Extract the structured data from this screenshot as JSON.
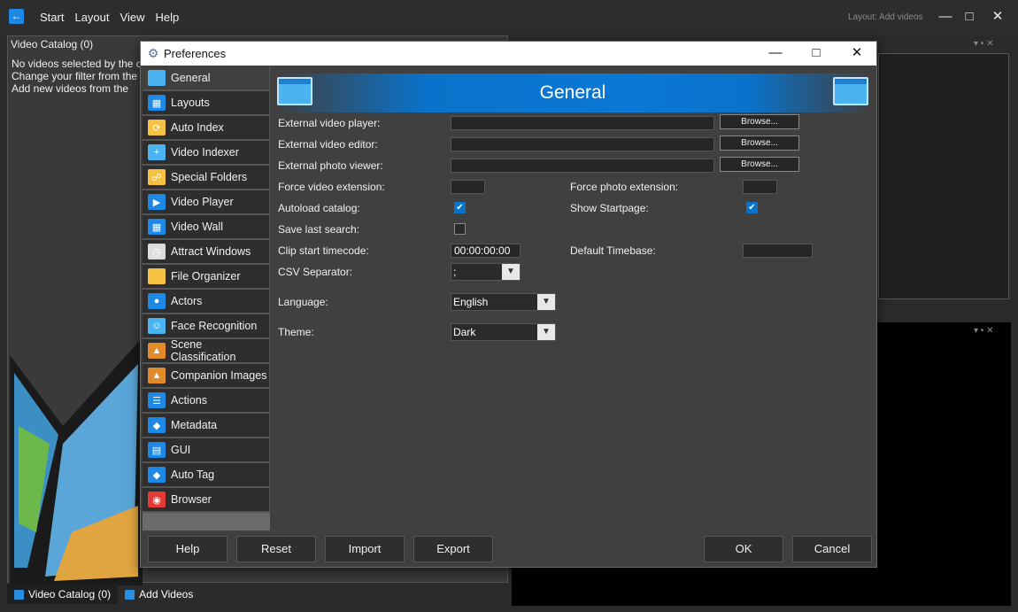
{
  "menu": [
    "Start",
    "Layout",
    "View",
    "Help"
  ],
  "layout_label": "Layout: Add videos",
  "left_panel": {
    "title": "Video Catalog (0)",
    "lines": [
      "No videos selected by the c",
      "Change your filter from the",
      "Add new videos from the"
    ]
  },
  "bottom_tabs": [
    "Video Catalog (0)",
    "Add Videos"
  ],
  "dialog": {
    "title": "Preferences",
    "banner_title": "General",
    "nav": [
      {
        "label": "General",
        "icon": "folder-icon",
        "color": "#4ab3f0"
      },
      {
        "label": "Layouts",
        "icon": "layout-icon",
        "color": "#1e88e5"
      },
      {
        "label": "Auto Index",
        "icon": "auto-index-icon",
        "color": "#f5c242"
      },
      {
        "label": "Video Indexer",
        "icon": "video-indexer-icon",
        "color": "#4ab3f0"
      },
      {
        "label": "Special Folders",
        "icon": "special-folder-icon",
        "color": "#f5c242"
      },
      {
        "label": "Video Player",
        "icon": "video-player-icon",
        "color": "#1e88e5"
      },
      {
        "label": "Video Wall",
        "icon": "video-wall-icon",
        "color": "#1e88e5"
      },
      {
        "label": "Attract Windows",
        "icon": "clock-icon",
        "color": "#dddddd"
      },
      {
        "label": "File Organizer",
        "icon": "file-organizer-icon",
        "color": "#f5c242"
      },
      {
        "label": "Actors",
        "icon": "actor-icon",
        "color": "#1e88e5"
      },
      {
        "label": "Face Recognition",
        "icon": "face-recognition-icon",
        "color": "#4ab3f0"
      },
      {
        "label": "Scene Classification",
        "icon": "scene-icon",
        "color": "#e08a2a"
      },
      {
        "label": "Companion Images",
        "icon": "image-icon",
        "color": "#e08a2a"
      },
      {
        "label": "Actions",
        "icon": "actions-icon",
        "color": "#1e88e5"
      },
      {
        "label": "Metadata",
        "icon": "tag-icon",
        "color": "#1e88e5"
      },
      {
        "label": "GUI",
        "icon": "gui-icon",
        "color": "#1e88e5"
      },
      {
        "label": "Auto Tag",
        "icon": "auto-tag-icon",
        "color": "#1e88e5"
      },
      {
        "label": "Browser",
        "icon": "chrome-icon",
        "color": "#e53935"
      }
    ],
    "form": {
      "external_video_player": {
        "label": "External video player:",
        "value": ""
      },
      "external_video_editor": {
        "label": "External video editor:",
        "value": ""
      },
      "external_photo_viewer": {
        "label": "External photo viewer:",
        "value": ""
      },
      "browse_label": "Browse...",
      "force_video_extension": {
        "label": "Force video extension:",
        "value": ""
      },
      "force_photo_extension": {
        "label": "Force photo extension:",
        "value": ""
      },
      "autoload_catalog": {
        "label": "Autoload catalog:",
        "checked": true
      },
      "show_startpage": {
        "label": "Show Startpage:",
        "checked": true
      },
      "save_last_search": {
        "label": "Save last search:",
        "checked": false
      },
      "clip_start_timecode": {
        "label": "Clip start timecode:",
        "value": "00:00:00:00"
      },
      "default_timebase": {
        "label": "Default Timebase:",
        "value": ""
      },
      "csv_separator": {
        "label": "CSV Separator:",
        "value": ";"
      },
      "language": {
        "label": "Language:",
        "value": "English"
      },
      "theme": {
        "label": "Theme:",
        "value": "Dark"
      }
    },
    "footer": {
      "help": "Help",
      "reset": "Reset",
      "import": "Import",
      "export": "Export",
      "ok": "OK",
      "cancel": "Cancel"
    }
  }
}
